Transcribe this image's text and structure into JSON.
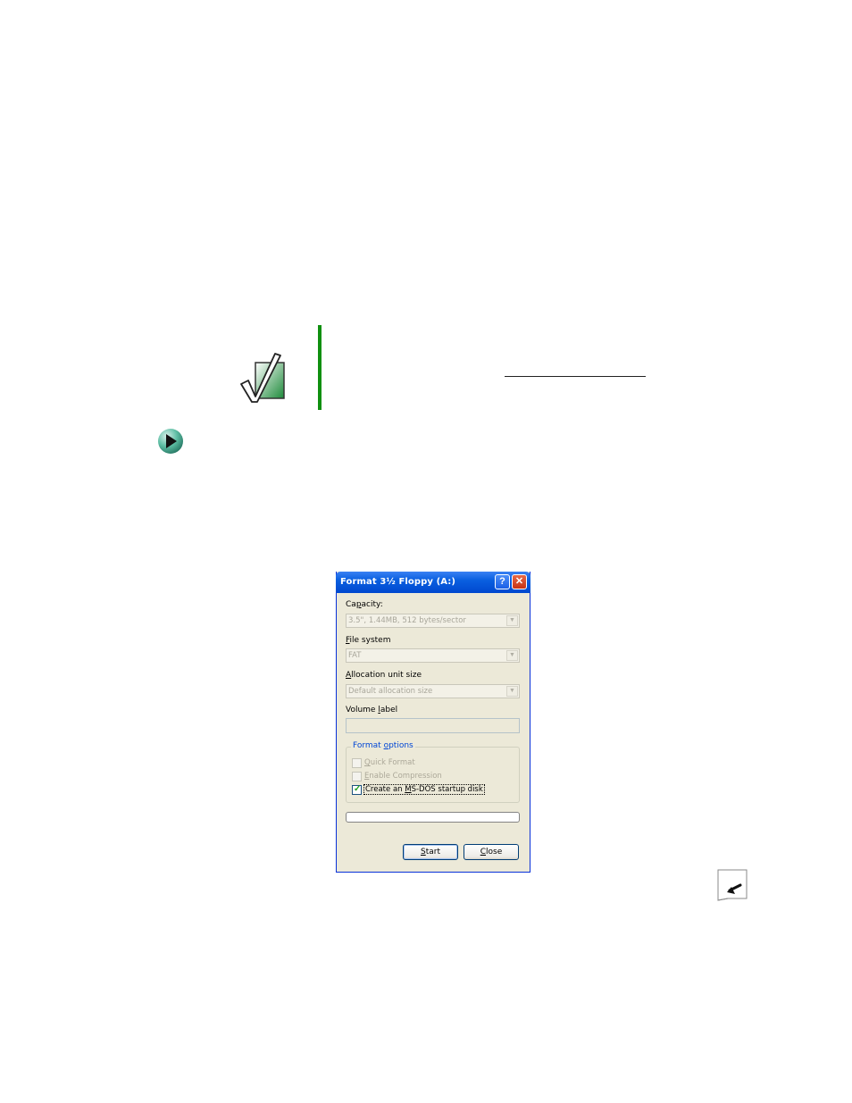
{
  "dialog": {
    "title": "Format 3½ Floppy (A:)",
    "help_glyph": "?",
    "close_glyph": "✕",
    "capacity": {
      "label_pre": "Ca",
      "label_u": "p",
      "label_post": "acity:",
      "value": "3.5\", 1.44MB, 512 bytes/sector"
    },
    "file_system": {
      "label_pre": "",
      "label_u": "F",
      "label_post": "ile system",
      "value": "FAT"
    },
    "allocation": {
      "label_pre": "",
      "label_u": "A",
      "label_post": "llocation unit size",
      "value": "Default allocation size"
    },
    "volume_label": {
      "label_pre": "Volume ",
      "label_u": "l",
      "label_post": "abel",
      "value": ""
    },
    "format_options": {
      "title_pre": "Format ",
      "title_u": "o",
      "title_post": "ptions",
      "quick_format": {
        "pre": "",
        "u": "Q",
        "post": "uick Format",
        "checked": false
      },
      "enable_compression": {
        "pre": "",
        "u": "E",
        "post": "nable Compression",
        "checked": false
      },
      "msdos_startup": {
        "pre": "Create an ",
        "u": "M",
        "post": "S-DOS startup disk",
        "checked": true
      }
    },
    "progress": 0,
    "start_button": {
      "u": "S",
      "post": "tart"
    },
    "close_button": {
      "u": "C",
      "post": "lose"
    }
  },
  "colors": {
    "accent_bar": "#109010",
    "titlebar": "#0a5fe0",
    "dialog_bg": "#ece9d8"
  },
  "icons": {
    "note": "checkmark-note-icon",
    "procedure": "procedure-arrow-icon",
    "page_corner": "page-corner-icon"
  }
}
